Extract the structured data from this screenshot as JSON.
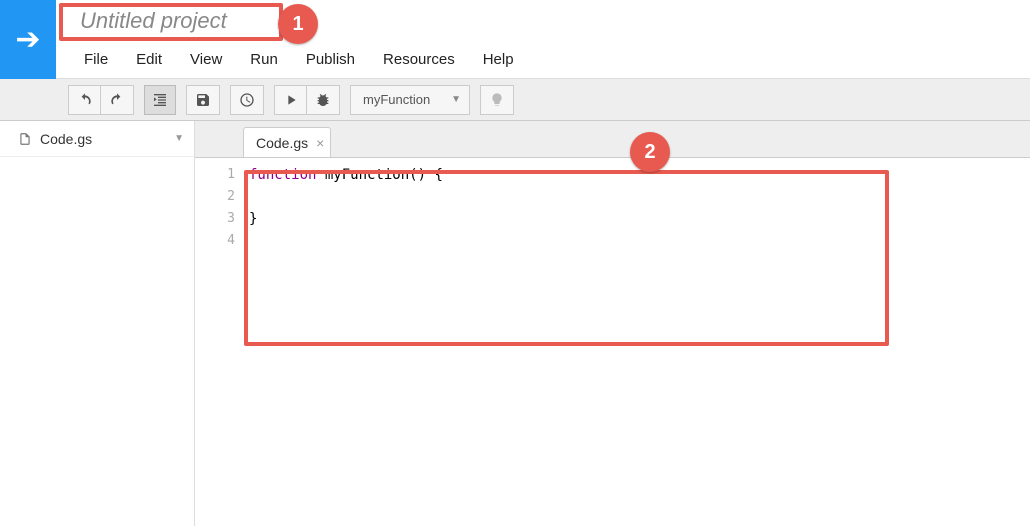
{
  "header": {
    "project_title": "Untitled project",
    "menu": {
      "file": "File",
      "edit": "Edit",
      "view": "View",
      "run": "Run",
      "publish": "Publish",
      "resources": "Resources",
      "help": "Help"
    }
  },
  "toolbar": {
    "function_select": "myFunction"
  },
  "sidebar": {
    "file": {
      "name": "Code.gs"
    }
  },
  "tabs": {
    "active": "Code.gs"
  },
  "editor": {
    "lines": {
      "1": "1",
      "2": "2",
      "3": "3",
      "4": "4"
    },
    "code": {
      "l1_kw": "function",
      "l1_rest": " myFunction() {",
      "l3": "}"
    }
  },
  "annotations": {
    "callout1": "1",
    "callout2": "2"
  }
}
